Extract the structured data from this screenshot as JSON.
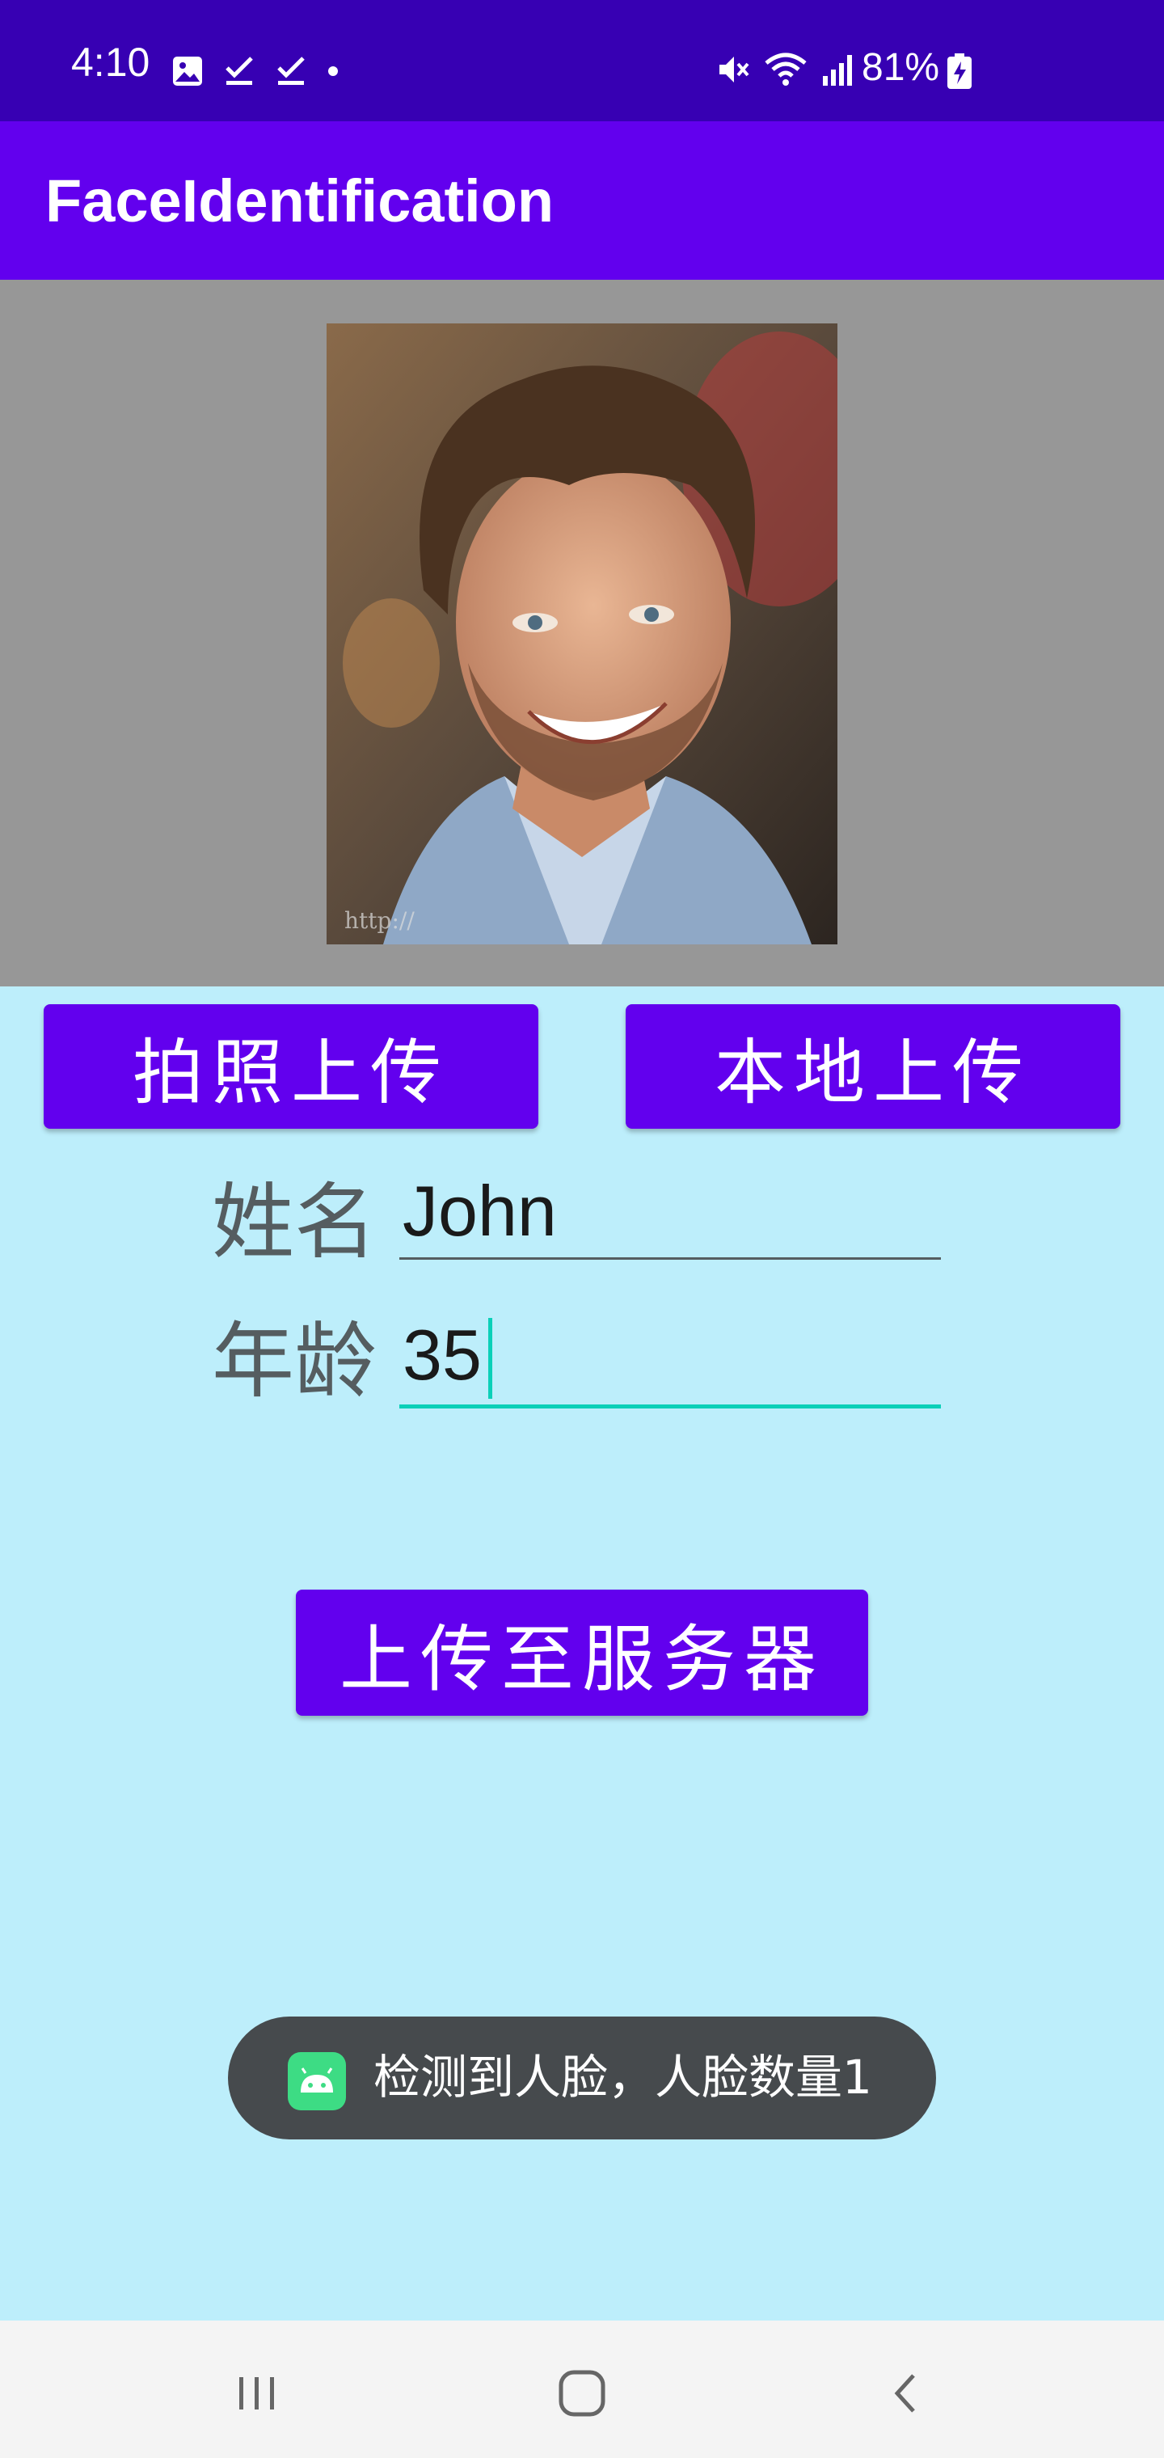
{
  "status_bar": {
    "time": "4:10",
    "battery": "81%",
    "icons_left": [
      "image-icon",
      "check-icon",
      "check-icon",
      "dot-icon"
    ],
    "icons_right": [
      "mute-icon",
      "wifi-icon",
      "signal-icon",
      "battery-charging-icon"
    ]
  },
  "app_bar": {
    "title": "FaceIdentification"
  },
  "image_panel": {
    "photo_watermark": "http://"
  },
  "buttons": {
    "camera_upload": "拍照上传",
    "local_upload": "本地上传",
    "server_upload": "上传至服务器"
  },
  "form": {
    "name_label": "姓名",
    "name_value": "John",
    "age_label": "年龄",
    "age_value": "35"
  },
  "toast": {
    "message": "检测到人脸，人脸数量1",
    "icon": "android-icon"
  },
  "nav_bar": {
    "buttons": [
      "recent-apps-icon",
      "home-icon",
      "back-icon"
    ]
  },
  "colors": {
    "status_bar": "#3700b3",
    "app_bar": "#6200ee",
    "button": "#6200ee",
    "background": "#bdeefb",
    "image_panel": "#979797",
    "focused_underline": "#0bd0b8",
    "toast_background": "#464a4d",
    "nav_background": "#f4f4f4"
  }
}
